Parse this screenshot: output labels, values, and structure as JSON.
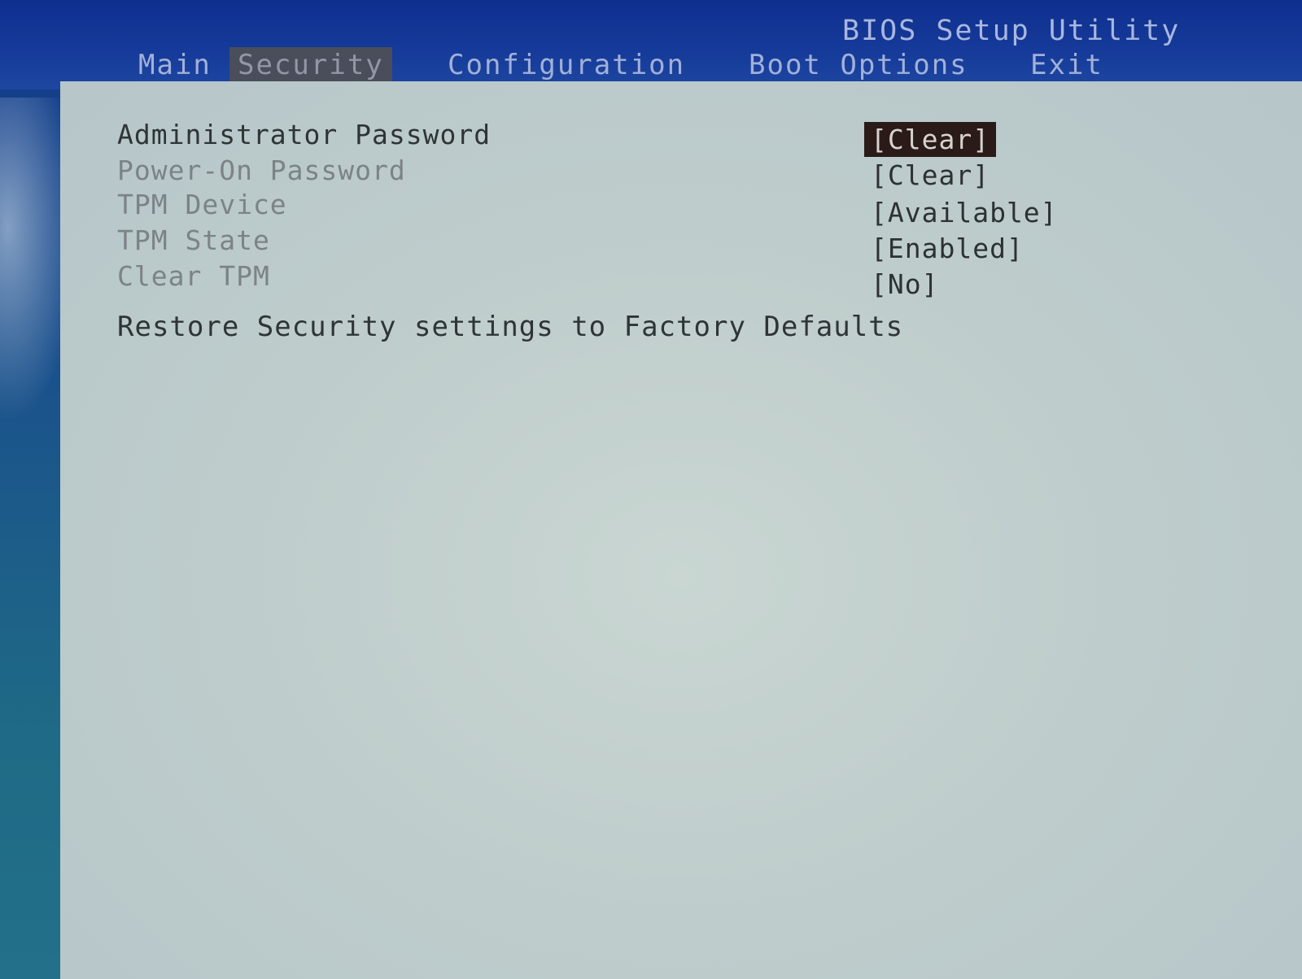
{
  "app": {
    "title": "BIOS Setup Utility"
  },
  "tabs": [
    {
      "label": "Main"
    },
    {
      "label": "Security"
    },
    {
      "label": "Configuration"
    },
    {
      "label": "Boot Options"
    },
    {
      "label": "Exit"
    }
  ],
  "active_tab": "Security",
  "security": {
    "items": [
      {
        "label": "Administrator Password",
        "value": "[Clear]"
      },
      {
        "label": "Power-On Password",
        "value": "[Clear]"
      },
      {
        "label": "TPM Device",
        "value": "[Available]"
      },
      {
        "label": "TPM State",
        "value": "[Enabled]"
      },
      {
        "label": "Clear TPM",
        "value": "[No]"
      }
    ],
    "restore_label": "Restore Security settings to Factory Defaults"
  },
  "colors": {
    "header_blue": "#163b9a",
    "panel_bg": "#c3d0ce",
    "selected_bg": "#2a1a18",
    "active_tab_bg": "#4a4e5a"
  }
}
